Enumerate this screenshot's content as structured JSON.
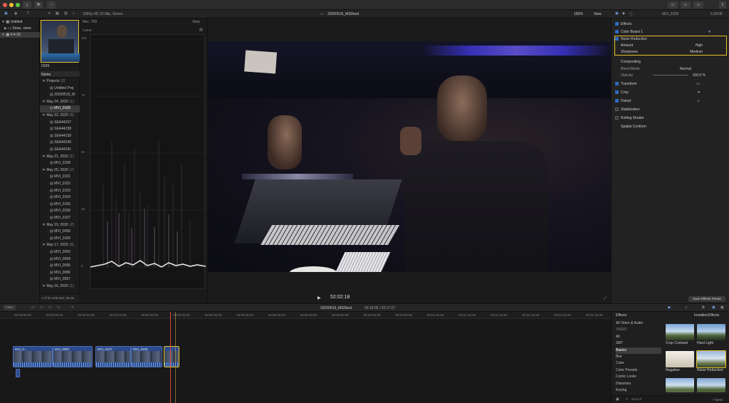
{
  "window": {
    "project_title": "20200516_MSDtest",
    "viewer_format": "1080p HD 23.98p, Stereo",
    "zoom": "150%",
    "view_label": "View"
  },
  "libraries": {
    "items": [
      {
        "label": "Untitled"
      },
      {
        "label": "Smar...tions"
      },
      {
        "label": "4-4-20"
      }
    ]
  },
  "browser": {
    "thumb_label": "0109",
    "column_header": "Name",
    "rows": [
      {
        "label": "Projects",
        "count": "(2)"
      },
      {
        "label": "Untitled Proj",
        "count": ""
      },
      {
        "label": "20200516_M",
        "count": ""
      },
      {
        "label": "May 24, 2020",
        "count": "(1)"
      },
      {
        "label": "MVI_0109",
        "count": ""
      },
      {
        "label": "May 22, 2020",
        "count": "(5)"
      },
      {
        "label": "SEA44237",
        "count": ""
      },
      {
        "label": "SEA44238",
        "count": ""
      },
      {
        "label": "SEA44239",
        "count": ""
      },
      {
        "label": "SEA44240",
        "count": ""
      },
      {
        "label": "SEA44241",
        "count": ""
      },
      {
        "label": "May 21, 2020",
        "count": "(1)"
      },
      {
        "label": "MVI_0108",
        "count": ""
      },
      {
        "label": "May 20, 2020",
        "count": "(7)"
      },
      {
        "label": "MVI_0101",
        "count": ""
      },
      {
        "label": "MVI_0102",
        "count": ""
      },
      {
        "label": "MVI_0103",
        "count": ""
      },
      {
        "label": "MVI_0104",
        "count": ""
      },
      {
        "label": "MVI_0105",
        "count": ""
      },
      {
        "label": "MVI_0106",
        "count": ""
      },
      {
        "label": "MVI_0107",
        "count": ""
      },
      {
        "label": "May 19, 2020",
        "count": "(2)"
      },
      {
        "label": "MVI_0099",
        "count": ""
      },
      {
        "label": "MVI_0100",
        "count": ""
      },
      {
        "label": "May 17, 2020",
        "count": "(5)"
      },
      {
        "label": "MVI_0093",
        "count": ""
      },
      {
        "label": "MVI_0094",
        "count": ""
      },
      {
        "label": "MVI_0095",
        "count": ""
      },
      {
        "label": "MVI_0096",
        "count": ""
      },
      {
        "label": "MVI_0097",
        "count": ""
      },
      {
        "label": "May 16, 2020",
        "count": "(1)"
      }
    ],
    "footer": "1 of 52 selected, 05:18..."
  },
  "scopes": {
    "mode": "Rec. 709",
    "view_label": "View",
    "scope_type": "Luma",
    "scale": [
      "100",
      "75",
      "50",
      "25",
      "0"
    ]
  },
  "viewer": {
    "timecode": "52:02:18"
  },
  "inspector": {
    "clip_name": "MVI_0109",
    "duration": "5:18:06",
    "rows": [
      {
        "label": "Effects",
        "value": ""
      },
      {
        "label": "Color Board 1",
        "value": ""
      },
      {
        "label": "Noise Reduction",
        "value": ""
      },
      {
        "label": "Amount",
        "value": "High"
      },
      {
        "label": "Sharpness",
        "value": "Medium"
      },
      {
        "label": "Compositing",
        "value": ""
      },
      {
        "label": "Blend Mode",
        "value": "Normal"
      },
      {
        "label": "Opacity",
        "value": "100.0 %"
      },
      {
        "label": "Transform",
        "value": ""
      },
      {
        "label": "Crop",
        "value": ""
      },
      {
        "label": "Distort",
        "value": ""
      },
      {
        "label": "Stabilization",
        "value": ""
      },
      {
        "label": "Rolling Shutter",
        "value": ""
      },
      {
        "label": "Spatial Conform",
        "value": ""
      }
    ],
    "save_preset": "Save Effects Preset"
  },
  "timeline": {
    "index_label": "Index",
    "project_name": "20200516_MSDtest",
    "timecode": "05:18:06 / 53:17:07",
    "ruler": [
      "00:00:00:00",
      "00:00:05:00",
      "00:00:10:00",
      "00:00:15:00",
      "00:00:20:00",
      "00:00:25:00",
      "00:00:30:00",
      "00:00:35:00",
      "00:00:40:00",
      "00:00:45:00",
      "00:00:50:00",
      "00:00:55:00",
      "00:01:00:00",
      "00:01:05:00",
      "00:01:10:00",
      "00:01:15:00",
      "00:01:20:00",
      "00:01:25:00",
      "00:01:30:00"
    ],
    "clips": [
      {
        "label": "MVI_0..."
      },
      {
        "label": "MVI_0097"
      },
      {
        "label": "MVI_0107"
      },
      {
        "label": "MVI_0108"
      },
      {
        "label": ""
      }
    ]
  },
  "effects": {
    "header": "Effects",
    "installed": "Installed Effects",
    "categories": [
      "All Video & Audio",
      "VIDEO",
      "All",
      "360°",
      "Basics",
      "Blur",
      "Color",
      "Color Presets",
      "Comic Looks",
      "Distortion",
      "Keying"
    ],
    "selected_category": "Basics",
    "items": [
      {
        "label": "Crop Contrast"
      },
      {
        "label": "Hard Light"
      },
      {
        "label": "Negative"
      },
      {
        "label": "Noise Reduction"
      },
      {
        "label": ""
      },
      {
        "label": ""
      }
    ],
    "search_placeholder": "Search",
    "count": "7 items"
  },
  "colors": {
    "accent": "#2e6cc4",
    "selection_yellow": "#e6c229",
    "playhead": "#d94a3a"
  }
}
